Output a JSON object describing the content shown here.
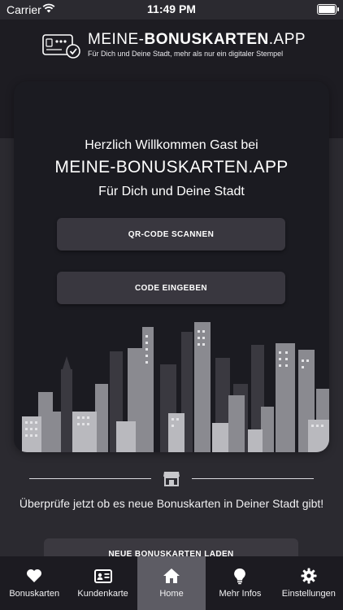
{
  "status_bar": {
    "carrier": "Carrier",
    "time": "11:49 PM"
  },
  "header": {
    "logo_title_part1": "MEINE-",
    "logo_title_part2": "BONUSKARTEN",
    "logo_title_part3": ".APP",
    "logo_tagline": "Für Dich und Deine Stadt, mehr als nur ein digitaler Stempel"
  },
  "welcome": {
    "line1": "Herzlich Willkommen Gast bei",
    "line2": "MEINE-BONUSKARTEN.APP",
    "line3": "Für Dich und Deine Stadt",
    "qr_button": "QR-CODE SCANNEN",
    "code_button": "CODE EINGEBEN"
  },
  "check_section": {
    "text": "Überprüfe jetzt ob es neue Bonuskarten in Deiner Stadt gibt!",
    "load_button": "NEUE BONUSKARTEN LADEN"
  },
  "tab_bar": {
    "tabs": [
      {
        "label": "Bonuskarten",
        "icon": "heart-icon"
      },
      {
        "label": "Kundenkarte",
        "icon": "id-card-icon"
      },
      {
        "label": "Home",
        "icon": "home-icon"
      },
      {
        "label": "Mehr Infos",
        "icon": "lightbulb-icon"
      },
      {
        "label": "Einstellungen",
        "icon": "gear-icon"
      }
    ],
    "active_tab": "Home"
  },
  "colors": {
    "background": "#2b2a30",
    "header": "#1d1c22",
    "card": "#1b1b21",
    "button": "#39373f",
    "tab_bar": "#1c1b21",
    "tab_active": "#5d5c64"
  }
}
